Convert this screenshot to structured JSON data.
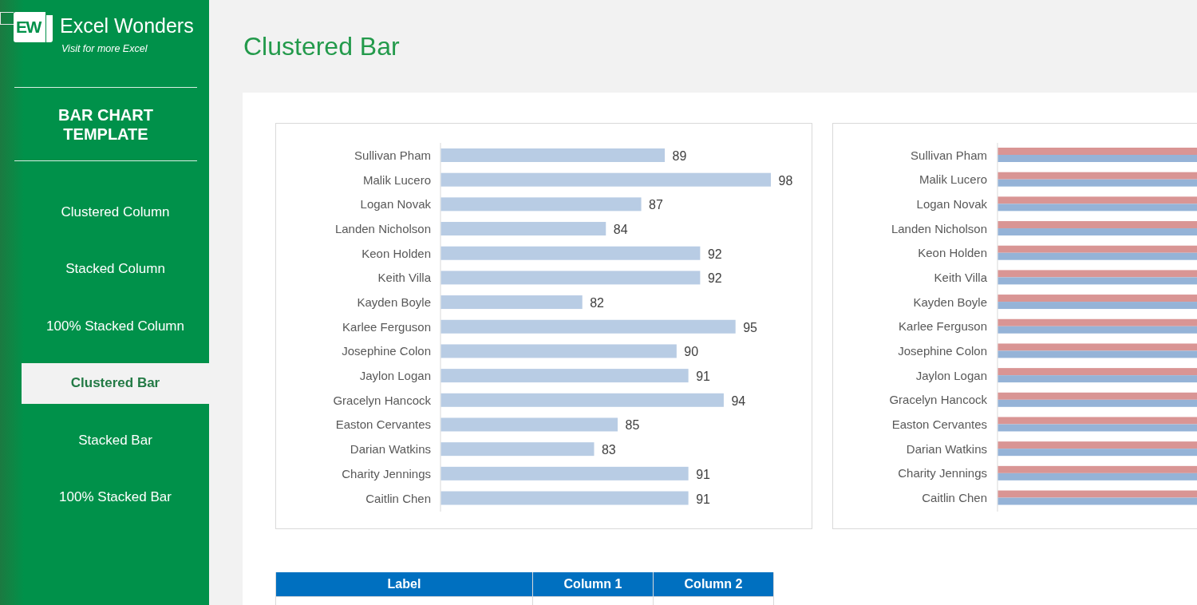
{
  "sidebar": {
    "logo": {
      "mark": "EW",
      "name": "Excel Wonders",
      "tagline": "Visit for more Excel"
    },
    "heading": "BAR CHART TEMPLATE",
    "items": [
      {
        "label": "Clustered Column",
        "selected": false
      },
      {
        "label": "Stacked Column",
        "selected": false
      },
      {
        "label": "100% Stacked Column",
        "selected": false
      },
      {
        "label": "Clustered Bar",
        "selected": true
      },
      {
        "label": "Stacked Bar",
        "selected": false
      },
      {
        "label": "100% Stacked Bar",
        "selected": false
      }
    ]
  },
  "page": {
    "title": "Clustered Bar"
  },
  "bar_chart": {
    "chart_data": {
      "type": "bar",
      "orientation": "horizontal",
      "categories": [
        "Sullivan Pham",
        "Malik Lucero",
        "Logan Novak",
        "Landen Nicholson",
        "Keon Holden",
        "Keith Villa",
        "Kayden Boyle",
        "Karlee Ferguson",
        "Josephine Colon",
        "Jaylon Logan",
        "Gracelyn Hancock",
        "Easton Cervantes",
        "Darian Watkins",
        "Charity Jennings",
        "Caitlin Chen"
      ],
      "values": [
        89,
        98,
        87,
        84,
        92,
        92,
        82,
        95,
        90,
        91,
        94,
        85,
        83,
        91,
        91
      ],
      "xlim": [
        70,
        98
      ],
      "data_labels": true
    }
  },
  "clustered_bar_chart": {
    "categories": [
      "Sullivan Pham",
      "Malik Lucero",
      "Logan Novak",
      "Landen Nicholson",
      "Keon Holden",
      "Keith Villa",
      "Kayden Boyle",
      "Karlee Ferguson",
      "Josephine Colon",
      "Jaylon Logan",
      "Gracelyn Hancock",
      "Easton Cervantes",
      "Darian Watkins",
      "Charity Jennings",
      "Caitlin Chen"
    ],
    "series": [
      {
        "color": "#d99594"
      },
      {
        "color": "#95b3d7"
      }
    ]
  },
  "table": {
    "columns": [
      "Label",
      "Column 1",
      "Column 2"
    ]
  }
}
